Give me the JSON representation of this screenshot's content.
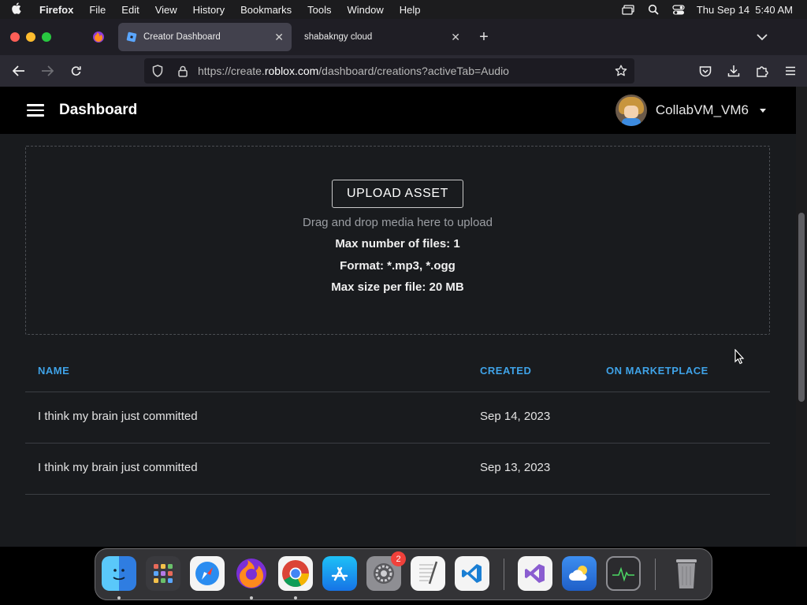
{
  "menubar": {
    "app": "Firefox",
    "items": [
      "File",
      "Edit",
      "View",
      "History",
      "Bookmarks",
      "Tools",
      "Window",
      "Help"
    ],
    "datetime": "Thu Sep 14  5:40 AM",
    "icons": [
      "screen-mirror-icon",
      "search-icon",
      "control-center-icon"
    ]
  },
  "tabs": [
    {
      "title": "Creator Dashboard",
      "active": true
    },
    {
      "title": "shabakngy cloud",
      "active": false
    }
  ],
  "url": {
    "prefix": "https://create.",
    "domain": "roblox.com",
    "path": "/dashboard/creations?activeTab=Audio"
  },
  "header": {
    "title": "Dashboard",
    "username": "CollabVM_VM6"
  },
  "upload": {
    "button": "UPLOAD ASSET",
    "hint": "Drag and drop media here to upload",
    "max_files": "Max number of files: 1",
    "format": "Format: *.mp3, *.ogg",
    "max_size": "Max size per file: 20 MB"
  },
  "table": {
    "headers": {
      "name": "NAME",
      "created": "CREATED",
      "marketplace": "ON MARKETPLACE"
    },
    "rows": [
      {
        "name": "I think my brain just committed",
        "created": "Sep 14, 2023"
      },
      {
        "name": "I think my brain just committed",
        "created": "Sep 13, 2023"
      }
    ]
  },
  "dock": {
    "apps": [
      "finder-icon",
      "launchpad-icon",
      "safari-icon",
      "firefox-icon",
      "chrome-icon",
      "app-store-icon",
      "system-settings-icon",
      "textedit-icon",
      "vscode-icon",
      "visual-studio-icon",
      "weather-icon",
      "activity-monitor-icon",
      "trash-icon"
    ],
    "settings_badge": "2"
  },
  "colors": {
    "accent_link": "#3fa3e8",
    "page_bg": "#191b1e",
    "header_bg": "#000000"
  }
}
